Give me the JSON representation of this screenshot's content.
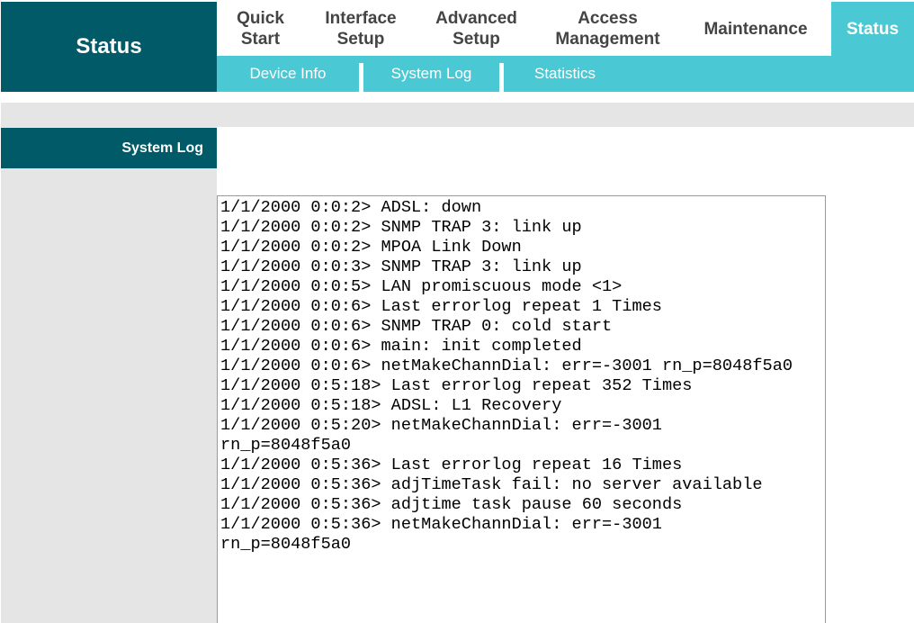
{
  "header": {
    "section_title": "Status",
    "tabs": [
      {
        "label_line1": "Quick",
        "label_line2": "Start"
      },
      {
        "label_line1": "Interface",
        "label_line2": "Setup"
      },
      {
        "label_line1": "Advanced",
        "label_line2": "Setup"
      },
      {
        "label_line1": "Access",
        "label_line2": "Management"
      },
      {
        "label_line1": "Maintenance",
        "label_line2": ""
      },
      {
        "label_line1": "Status",
        "label_line2": ""
      }
    ],
    "subtabs": [
      "Device Info",
      "System Log",
      "Statistics"
    ]
  },
  "sidebar": {
    "section_label": "System Log"
  },
  "log": {
    "lines": [
      "1/1/2000 0:0:2> ADSL: down",
      "1/1/2000 0:0:2> SNMP TRAP 3: link up",
      "1/1/2000 0:0:2> MPOA Link Down",
      "1/1/2000 0:0:3> SNMP TRAP 3: link up",
      "1/1/2000 0:0:5> LAN promiscuous mode <1>",
      "1/1/2000 0:0:6> Last errorlog repeat 1 Times",
      "1/1/2000 0:0:6> SNMP TRAP 0: cold start",
      "1/1/2000 0:0:6> main: init completed",
      "1/1/2000 0:0:6> netMakeChannDial: err=-3001 rn_p=8048f5a0",
      "1/1/2000 0:5:18> Last errorlog repeat 352 Times",
      "1/1/2000 0:5:18> ADSL: L1 Recovery",
      "1/1/2000 0:5:20> netMakeChannDial: err=-3001",
      "rn_p=8048f5a0",
      "1/1/2000 0:5:36> Last errorlog repeat 16 Times",
      "1/1/2000 0:5:36> adjTimeTask fail: no server available",
      "1/1/2000 0:5:36> adjtime task pause 60 seconds",
      "1/1/2000 0:5:36> netMakeChannDial: err=-3001",
      "rn_p=8048f5a0"
    ]
  }
}
